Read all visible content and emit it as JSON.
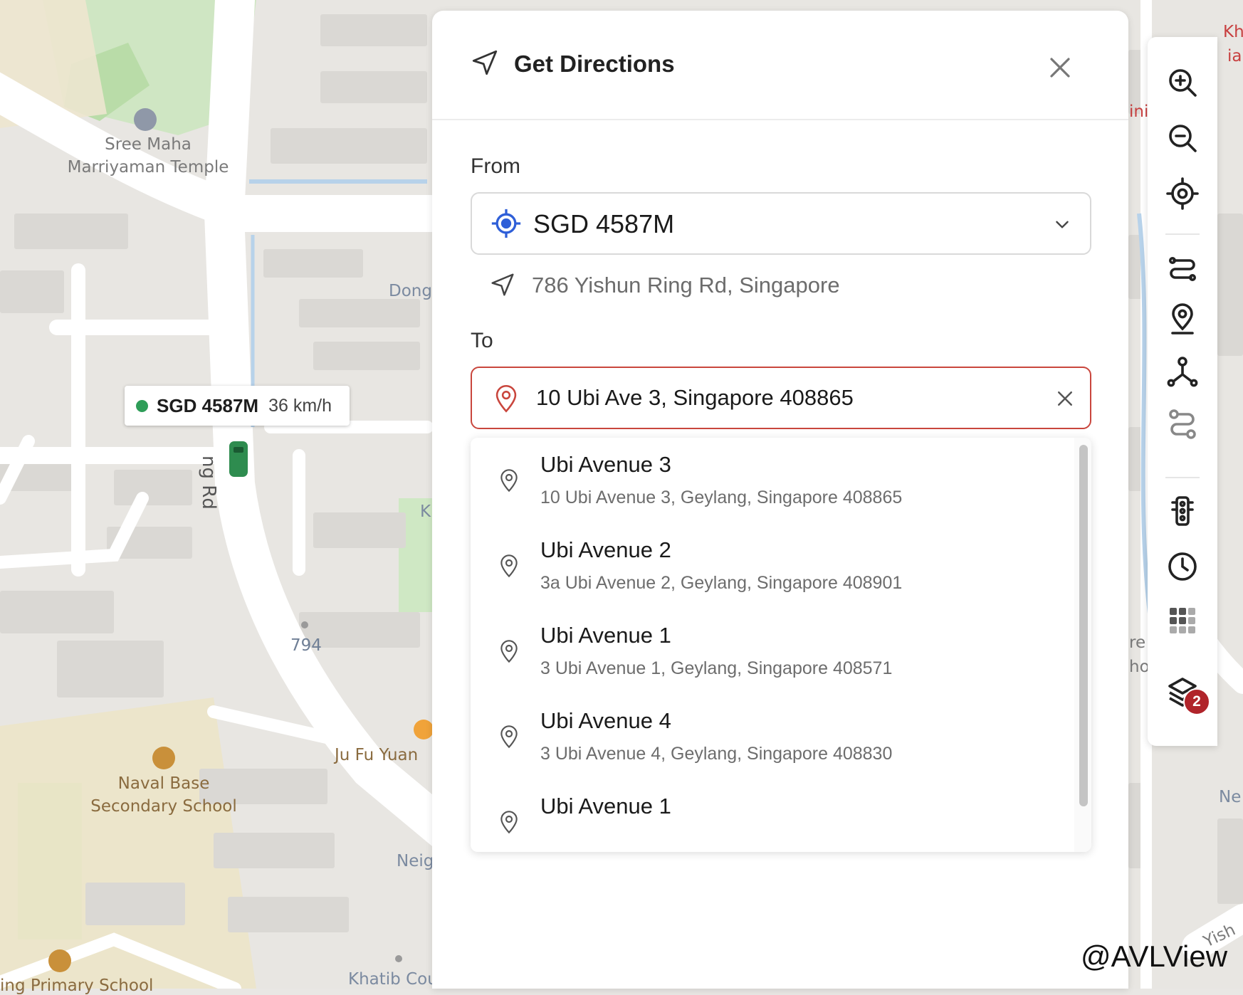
{
  "map": {
    "labels": {
      "temple_line1": "Sree Maha",
      "temple_line2": "Marriyaman Temple",
      "dong": "Dong",
      "ring_rd": "ng Rd",
      "k": "K",
      "block_794": "794",
      "ju_fu_yuan": "Ju Fu Yuan",
      "school_line1": "Naval Base",
      "school_line2": "Secondary School",
      "neig": "Neig",
      "primary_school": "ing Primary School",
      "khatib": "Khatib Cou",
      "kh": "Kh",
      "ia": "ia",
      "ini": "ini",
      "re": "re",
      "ho": "ho",
      "ne": "Ne",
      "yish": "Yish"
    }
  },
  "vehicle_tooltip": {
    "plate": "SGD 4587M",
    "speed": "36 km/h",
    "status_color": "#2e9d58"
  },
  "directions_panel": {
    "title": "Get Directions",
    "from_label": "From",
    "from_value": "SGD 4587M",
    "from_address": "786 Yishun Ring Rd, Singapore",
    "to_label": "To",
    "to_value": "10 Ubi Ave 3, Singapore 408865",
    "accent_color": "#2f5fd8",
    "error_color": "#c9463d",
    "suggestions": [
      {
        "name": "Ubi Avenue 3",
        "address": "10 Ubi Avenue 3, Geylang, Singapore 408865"
      },
      {
        "name": "Ubi Avenue 2",
        "address": "3a Ubi Avenue 2, Geylang, Singapore 408901"
      },
      {
        "name": "Ubi Avenue 1",
        "address": "3 Ubi Avenue 1, Geylang, Singapore 408571"
      },
      {
        "name": "Ubi Avenue 4",
        "address": "3 Ubi Avenue 4, Geylang, Singapore 408830"
      },
      {
        "name": "Ubi Avenue 1",
        "address": ""
      }
    ]
  },
  "toolbar": {
    "tools": [
      "zoom-in-icon",
      "zoom-out-icon",
      "locate-icon",
      "route-icon",
      "place-pin-icon",
      "waypoints-icon",
      "route-path-icon",
      "traffic-light-icon",
      "history-clock-icon",
      "grid-icon",
      "layers-icon"
    ],
    "layers_badge": "2",
    "badge_color": "#b0242a"
  },
  "watermark": "@AVLView"
}
